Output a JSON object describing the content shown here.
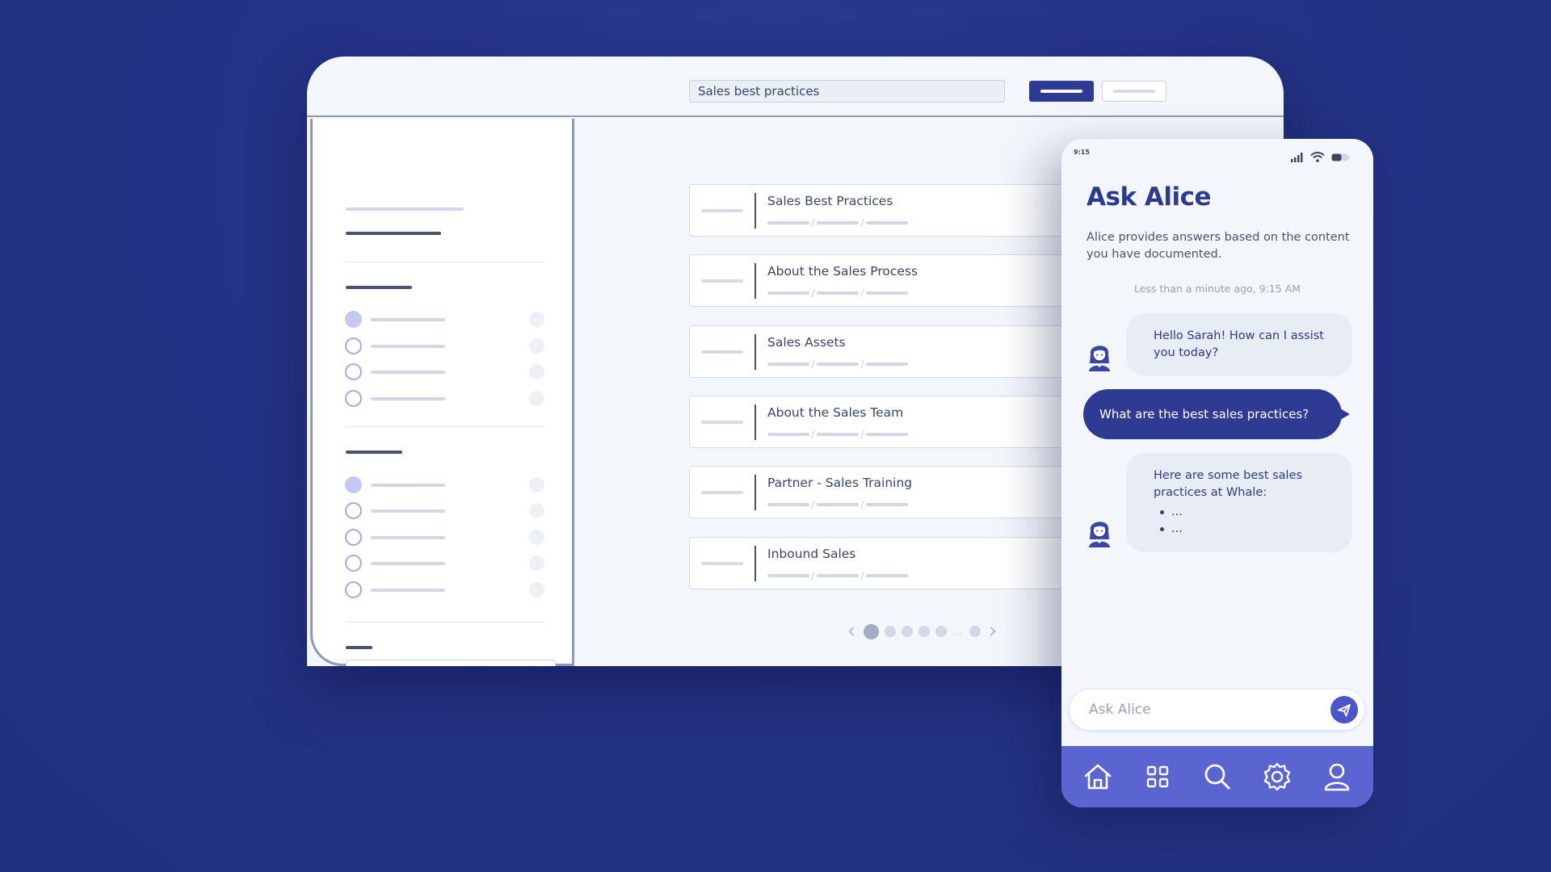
{
  "desktop": {
    "search": {
      "value": "Sales best practices"
    },
    "results": [
      {
        "title": "Sales Best Practices"
      },
      {
        "title": "About the Sales Process"
      },
      {
        "title": "Sales Assets"
      },
      {
        "title": "About the Sales Team"
      },
      {
        "title": "Partner - Sales Training"
      },
      {
        "title": "Inbound Sales"
      }
    ],
    "pagination": {
      "current_page": 1,
      "ellipsis": "..."
    }
  },
  "phone": {
    "status_time": "9:15",
    "title": "Ask Alice",
    "subtitle": "Alice provides answers based on the content you have documented.",
    "timestamp": "Less than a minute ago, 9:15 AM",
    "messages": {
      "bot_greeting": "Hello Sarah! How can I assist you today?",
      "user_question": "What are the best sales practices?",
      "bot_answer": "Here are some best sales practices at Whale:",
      "bot_answer_bullets": [
        "...",
        "..."
      ]
    },
    "input": {
      "placeholder": "Ask Alice"
    },
    "nav": [
      "home-icon",
      "grid-icon",
      "search-icon",
      "settings-icon",
      "profile-icon"
    ]
  },
  "colors": {
    "background": "#253386",
    "brand": "#2f3b93",
    "nav_bar": "#5a65d1",
    "bubble_in": "#e8ecf4"
  }
}
